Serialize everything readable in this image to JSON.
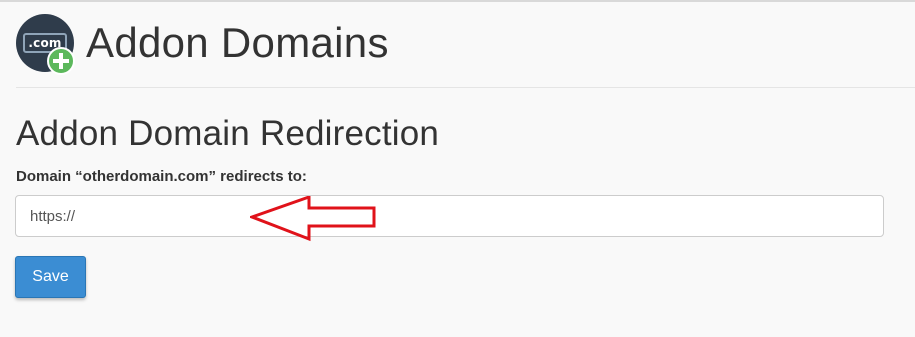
{
  "header": {
    "icon_text": ".com",
    "title": "Addon Domains"
  },
  "section": {
    "title": "Addon Domain Redirection",
    "field_label": "Domain “otherdomain.com” redirects to:",
    "url_value": "https://"
  },
  "actions": {
    "save_label": "Save"
  },
  "colors": {
    "save_button": "#3b8dd3",
    "annotation_arrow": "#e0121a",
    "icon_background": "#2f3c4b",
    "icon_plus": "#5cb85c"
  },
  "icons": {
    "app_icon": "addon-domain-icon",
    "annotation": "left-arrow-annotation"
  }
}
